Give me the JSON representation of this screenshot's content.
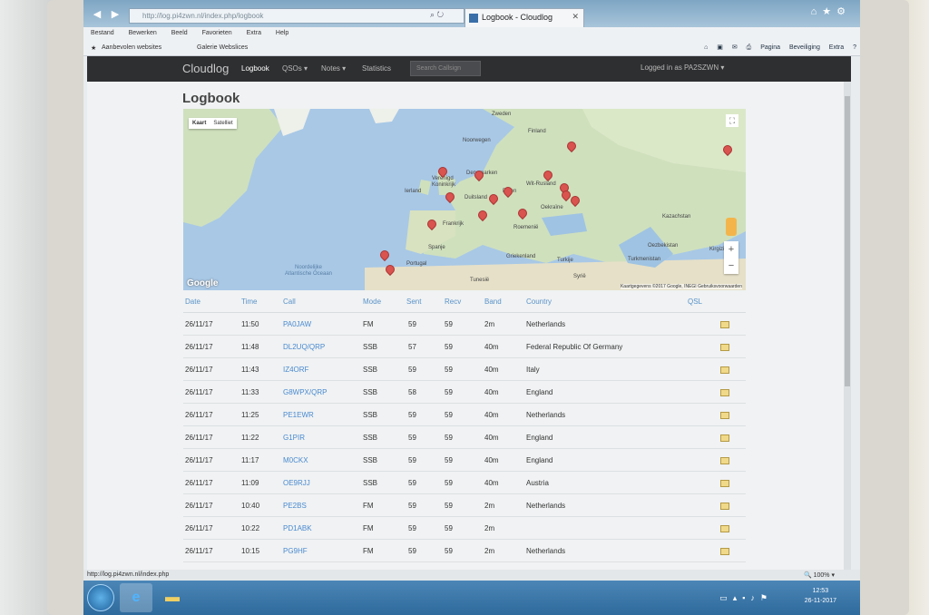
{
  "browser": {
    "address": "http://log.pi4zwn.nl/index.php/logbook",
    "tab_title": "Logbook - Cloudlog",
    "menu": [
      "Bestand",
      "Bewerken",
      "Beeld",
      "Favorieten",
      "Extra",
      "Help"
    ],
    "favorites": [
      "Aanbevolen websites",
      "Galerie Webslices"
    ],
    "commands": [
      "Pagina",
      "Beveiliging",
      "Extra"
    ],
    "status_url": "http://log.pi4zwn.nl/index.php",
    "zoom": "100%"
  },
  "navbar": {
    "brand": "Cloudlog",
    "links": [
      "Logbook",
      "QSOs",
      "Notes",
      "Statistics"
    ],
    "search_placeholder": "Search Callsign",
    "logged_in": "Logged in as PA2SZWN"
  },
  "page": {
    "title": "Logbook"
  },
  "map": {
    "controls": {
      "map": "Kaart",
      "satellite": "Satelliet"
    },
    "logo": "Google",
    "attribution": "Kaartgegevens ©2017 Google, INEGI   Gebruiksvoorwaarden",
    "labels": {
      "sweden": "Zweden",
      "finland": "Finland",
      "norway": "Noorwegen",
      "ireland": "Ierland",
      "uk": "Verenigd Koninkrijk",
      "denmark": "Denemarken",
      "germany": "Duitsland",
      "poland": "Polen",
      "belarus": "Wit-Rusland",
      "ukraine": "Oekraïne",
      "kazakhstan": "Kazachstan",
      "france": "Frankrijk",
      "romania": "Roemenië",
      "spain": "Spanje",
      "portugal": "Portugal",
      "greece": "Griekenland",
      "turkey": "Turkije",
      "uzbekistan": "Oezbekistan",
      "turkmenistan": "Turkmenistan",
      "kyrgyzstan": "Kirgizië",
      "syria": "Syrië",
      "tunisia": "Tunesië",
      "ocean": "Noordelijke Atlantische Oceaan"
    }
  },
  "table": {
    "headers": [
      "Date",
      "Time",
      "Call",
      "Mode",
      "Sent",
      "Recv",
      "Band",
      "Country",
      "QSL"
    ],
    "rows": [
      {
        "date": "26/11/17",
        "time": "11:50",
        "call": "PA0JAW",
        "mode": "FM",
        "sent": "59",
        "recv": "59",
        "band": "2m",
        "country": "Netherlands"
      },
      {
        "date": "26/11/17",
        "time": "11:48",
        "call": "DL2UQ/QRP",
        "mode": "SSB",
        "sent": "57",
        "recv": "59",
        "band": "40m",
        "country": "Federal Republic Of Germany"
      },
      {
        "date": "26/11/17",
        "time": "11:43",
        "call": "IZ4ORF",
        "mode": "SSB",
        "sent": "59",
        "recv": "59",
        "band": "40m",
        "country": "Italy"
      },
      {
        "date": "26/11/17",
        "time": "11:33",
        "call": "G8WPX/QRP",
        "mode": "SSB",
        "sent": "58",
        "recv": "59",
        "band": "40m",
        "country": "England"
      },
      {
        "date": "26/11/17",
        "time": "11:25",
        "call": "PE1EWR",
        "mode": "SSB",
        "sent": "59",
        "recv": "59",
        "band": "40m",
        "country": "Netherlands"
      },
      {
        "date": "26/11/17",
        "time": "11:22",
        "call": "G1PIR",
        "mode": "SSB",
        "sent": "59",
        "recv": "59",
        "band": "40m",
        "country": "England"
      },
      {
        "date": "26/11/17",
        "time": "11:17",
        "call": "M0CKX",
        "mode": "SSB",
        "sent": "59",
        "recv": "59",
        "band": "40m",
        "country": "England"
      },
      {
        "date": "26/11/17",
        "time": "11:09",
        "call": "OE9RJJ",
        "mode": "SSB",
        "sent": "59",
        "recv": "59",
        "band": "40m",
        "country": "Austria"
      },
      {
        "date": "26/11/17",
        "time": "10:40",
        "call": "PE2BS",
        "mode": "FM",
        "sent": "59",
        "recv": "59",
        "band": "2m",
        "country": "Netherlands"
      },
      {
        "date": "26/11/17",
        "time": "10:22",
        "call": "PD1ABK",
        "mode": "FM",
        "sent": "59",
        "recv": "59",
        "band": "2m",
        "country": ""
      },
      {
        "date": "26/11/17",
        "time": "10:15",
        "call": "PG9HF",
        "mode": "FM",
        "sent": "59",
        "recv": "59",
        "band": "2m",
        "country": "Netherlands"
      }
    ]
  },
  "taskbar": {
    "time": "12:53",
    "date": "26-11-2017"
  }
}
